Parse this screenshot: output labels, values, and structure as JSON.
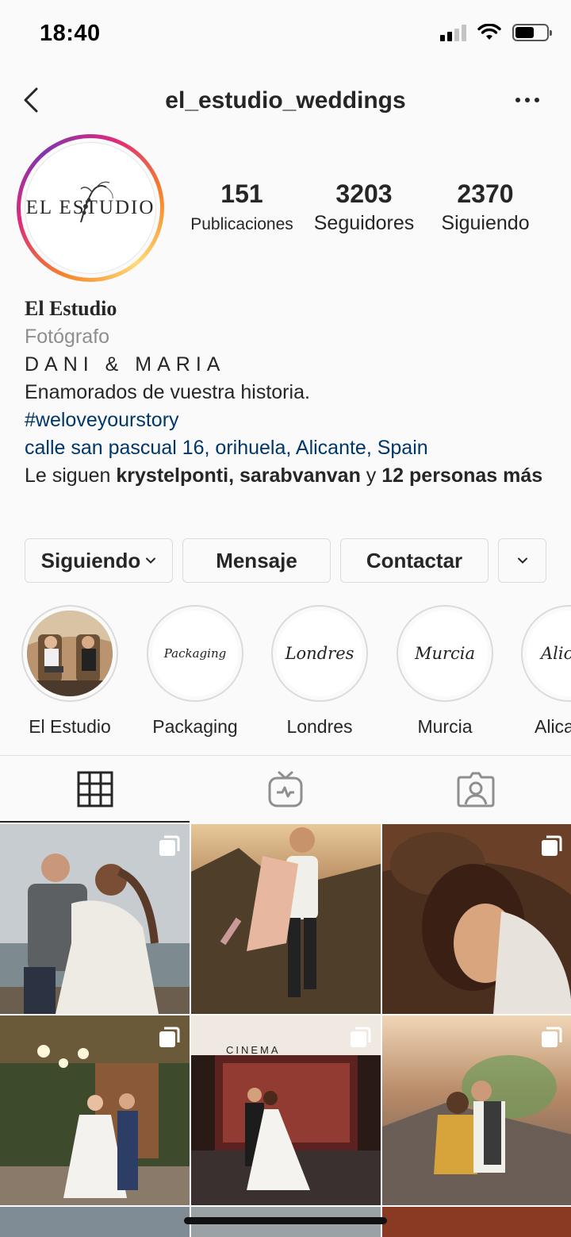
{
  "status_bar": {
    "time": "18:40"
  },
  "nav": {
    "username": "el_estudio_weddings"
  },
  "avatar": {
    "logo_text": "EL ESTUDIO"
  },
  "stats": [
    {
      "value": "151",
      "label": "Publicaciones"
    },
    {
      "value": "3203",
      "label": "Seguidores"
    },
    {
      "value": "2370",
      "label": "Siguiendo"
    }
  ],
  "bio": {
    "name": "El Estudio",
    "category": "Fotógrafo",
    "line1": "DANI & MARIA",
    "line2": "Enamorados de vuestra historia.",
    "hashtag": "#weloveyourstory",
    "address": "calle san pascual 16, orihuela, Alicante, Spain",
    "followed_by_prefix": "Le siguen ",
    "followed_by_user1": "krystelponti",
    "followed_by_sep": ", ",
    "followed_by_user2": "sarabvanvan",
    "followed_by_and": " y ",
    "followed_by_more": "12 personas más"
  },
  "buttons": {
    "following": "Siguiendo",
    "message": "Mensaje",
    "contact": "Contactar"
  },
  "highlights": [
    {
      "label": "El Estudio",
      "cover_text": ""
    },
    {
      "label": "Packaging",
      "cover_text": "Packaging"
    },
    {
      "label": "Londres",
      "cover_text": "Londres"
    },
    {
      "label": "Murcia",
      "cover_text": "Murcia"
    },
    {
      "label": "Alica",
      "cover_text": "Alica"
    }
  ],
  "tabs": [
    {
      "icon": "grid-icon",
      "active": true
    },
    {
      "icon": "igtv-icon",
      "active": false
    },
    {
      "icon": "tagged-icon",
      "active": false
    }
  ],
  "grid_posts": [
    {
      "multi": true,
      "palette": "beach-couple"
    },
    {
      "multi": false,
      "palette": "sunset-hug"
    },
    {
      "multi": true,
      "palette": "warm-embrace"
    },
    {
      "multi": true,
      "palette": "garden-wedding"
    },
    {
      "multi": true,
      "palette": "cinema-dance",
      "text": "CINEMA"
    },
    {
      "multi": true,
      "palette": "smoke-kiss"
    }
  ],
  "colors": {
    "link": "#00376b",
    "secondary_text": "#8e8e8e",
    "border": "#dbdbdb",
    "ring_gradient": [
      "#f58529",
      "#dd2a7b",
      "#8134af"
    ]
  }
}
